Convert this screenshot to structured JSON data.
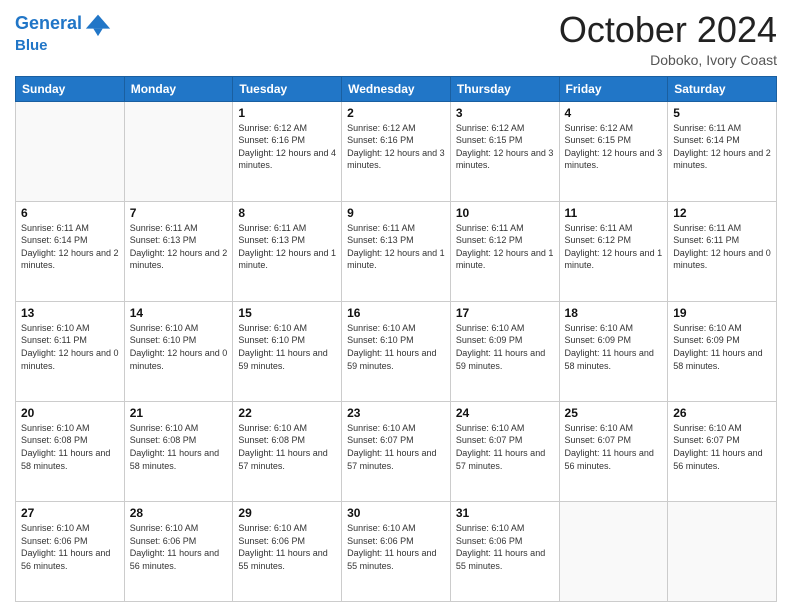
{
  "header": {
    "logo_line1": "General",
    "logo_line2": "Blue",
    "month": "October 2024",
    "location": "Doboko, Ivory Coast"
  },
  "weekdays": [
    "Sunday",
    "Monday",
    "Tuesday",
    "Wednesday",
    "Thursday",
    "Friday",
    "Saturday"
  ],
  "weeks": [
    [
      {
        "day": "",
        "empty": true
      },
      {
        "day": "",
        "empty": true
      },
      {
        "day": "1",
        "sunrise": "6:12 AM",
        "sunset": "6:16 PM",
        "daylight": "12 hours and 4 minutes."
      },
      {
        "day": "2",
        "sunrise": "6:12 AM",
        "sunset": "6:16 PM",
        "daylight": "12 hours and 3 minutes."
      },
      {
        "day": "3",
        "sunrise": "6:12 AM",
        "sunset": "6:15 PM",
        "daylight": "12 hours and 3 minutes."
      },
      {
        "day": "4",
        "sunrise": "6:12 AM",
        "sunset": "6:15 PM",
        "daylight": "12 hours and 3 minutes."
      },
      {
        "day": "5",
        "sunrise": "6:11 AM",
        "sunset": "6:14 PM",
        "daylight": "12 hours and 2 minutes."
      }
    ],
    [
      {
        "day": "6",
        "sunrise": "6:11 AM",
        "sunset": "6:14 PM",
        "daylight": "12 hours and 2 minutes."
      },
      {
        "day": "7",
        "sunrise": "6:11 AM",
        "sunset": "6:13 PM",
        "daylight": "12 hours and 2 minutes."
      },
      {
        "day": "8",
        "sunrise": "6:11 AM",
        "sunset": "6:13 PM",
        "daylight": "12 hours and 1 minute."
      },
      {
        "day": "9",
        "sunrise": "6:11 AM",
        "sunset": "6:13 PM",
        "daylight": "12 hours and 1 minute."
      },
      {
        "day": "10",
        "sunrise": "6:11 AM",
        "sunset": "6:12 PM",
        "daylight": "12 hours and 1 minute."
      },
      {
        "day": "11",
        "sunrise": "6:11 AM",
        "sunset": "6:12 PM",
        "daylight": "12 hours and 1 minute."
      },
      {
        "day": "12",
        "sunrise": "6:11 AM",
        "sunset": "6:11 PM",
        "daylight": "12 hours and 0 minutes."
      }
    ],
    [
      {
        "day": "13",
        "sunrise": "6:10 AM",
        "sunset": "6:11 PM",
        "daylight": "12 hours and 0 minutes."
      },
      {
        "day": "14",
        "sunrise": "6:10 AM",
        "sunset": "6:10 PM",
        "daylight": "12 hours and 0 minutes."
      },
      {
        "day": "15",
        "sunrise": "6:10 AM",
        "sunset": "6:10 PM",
        "daylight": "11 hours and 59 minutes."
      },
      {
        "day": "16",
        "sunrise": "6:10 AM",
        "sunset": "6:10 PM",
        "daylight": "11 hours and 59 minutes."
      },
      {
        "day": "17",
        "sunrise": "6:10 AM",
        "sunset": "6:09 PM",
        "daylight": "11 hours and 59 minutes."
      },
      {
        "day": "18",
        "sunrise": "6:10 AM",
        "sunset": "6:09 PM",
        "daylight": "11 hours and 58 minutes."
      },
      {
        "day": "19",
        "sunrise": "6:10 AM",
        "sunset": "6:09 PM",
        "daylight": "11 hours and 58 minutes."
      }
    ],
    [
      {
        "day": "20",
        "sunrise": "6:10 AM",
        "sunset": "6:08 PM",
        "daylight": "11 hours and 58 minutes."
      },
      {
        "day": "21",
        "sunrise": "6:10 AM",
        "sunset": "6:08 PM",
        "daylight": "11 hours and 58 minutes."
      },
      {
        "day": "22",
        "sunrise": "6:10 AM",
        "sunset": "6:08 PM",
        "daylight": "11 hours and 57 minutes."
      },
      {
        "day": "23",
        "sunrise": "6:10 AM",
        "sunset": "6:07 PM",
        "daylight": "11 hours and 57 minutes."
      },
      {
        "day": "24",
        "sunrise": "6:10 AM",
        "sunset": "6:07 PM",
        "daylight": "11 hours and 57 minutes."
      },
      {
        "day": "25",
        "sunrise": "6:10 AM",
        "sunset": "6:07 PM",
        "daylight": "11 hours and 56 minutes."
      },
      {
        "day": "26",
        "sunrise": "6:10 AM",
        "sunset": "6:07 PM",
        "daylight": "11 hours and 56 minutes."
      }
    ],
    [
      {
        "day": "27",
        "sunrise": "6:10 AM",
        "sunset": "6:06 PM",
        "daylight": "11 hours and 56 minutes."
      },
      {
        "day": "28",
        "sunrise": "6:10 AM",
        "sunset": "6:06 PM",
        "daylight": "11 hours and 56 minutes."
      },
      {
        "day": "29",
        "sunrise": "6:10 AM",
        "sunset": "6:06 PM",
        "daylight": "11 hours and 55 minutes."
      },
      {
        "day": "30",
        "sunrise": "6:10 AM",
        "sunset": "6:06 PM",
        "daylight": "11 hours and 55 minutes."
      },
      {
        "day": "31",
        "sunrise": "6:10 AM",
        "sunset": "6:06 PM",
        "daylight": "11 hours and 55 minutes."
      },
      {
        "day": "",
        "empty": true
      },
      {
        "day": "",
        "empty": true
      }
    ]
  ]
}
